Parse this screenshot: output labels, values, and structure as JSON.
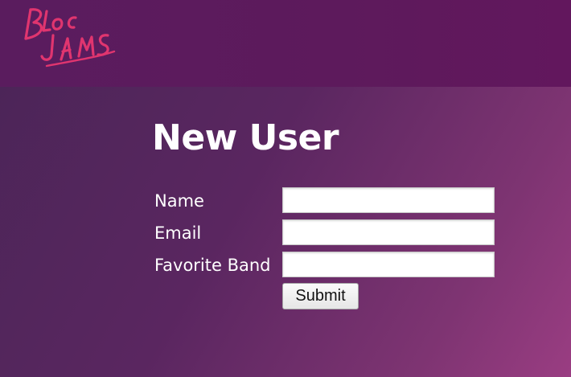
{
  "header": {
    "logo_text": "Bloc Jams"
  },
  "main": {
    "title": "New User",
    "fields": [
      {
        "label": "Name",
        "value": "",
        "placeholder": ""
      },
      {
        "label": "Email",
        "value": "",
        "placeholder": ""
      },
      {
        "label": "Favorite Band",
        "value": "",
        "placeholder": ""
      }
    ],
    "submit_label": "Submit"
  },
  "colors": {
    "navbar": "#5d1a5c",
    "background_start": "#4a2557",
    "background_end": "#9a3d82",
    "logo": "#e0356f",
    "text": "#ffffff"
  }
}
